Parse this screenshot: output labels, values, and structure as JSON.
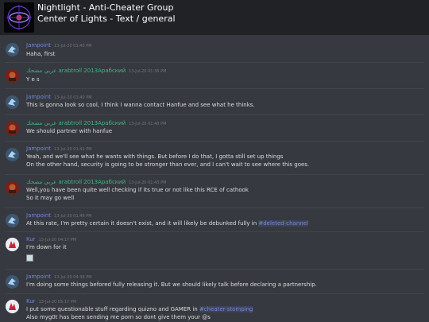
{
  "header": {
    "guild_name": "Nightlight - Anti-Cheater Group",
    "channel_name": "Center of Lights - Text / general"
  },
  "messages": [
    {
      "author": "Jampoint",
      "timestamp": "13-Jul-20 01:40 PM",
      "lines": [
        "Haha, first"
      ]
    },
    {
      "author": "عربي مضحك arabtroll 2013Арабский",
      "timestamp": "13-Jul-20 01:36 PM",
      "lines": [
        "Y e s"
      ]
    },
    {
      "author": "Jampoint",
      "timestamp": "13-Jul-20 01:40 PM",
      "lines": [
        "This is gonna look so cool, I think I wanna contact Hanfue and see what he thinks."
      ]
    },
    {
      "author": "عربي مضحك arabtroll 2013Арабский",
      "timestamp": "13-Jul-20 01:40 PM",
      "lines": [
        "We should partner with hanfue"
      ]
    },
    {
      "author": "Jampoint",
      "timestamp": "13-Jul-20 01:41 PM",
      "lines": [
        "Yeah, and we'll see what he wants with things. But before I do that, I gotta still set up things",
        "On the other hand, security is going to be stronger than ever, and I can't wait to see where this goes."
      ]
    },
    {
      "author": "عربي مضحك arabtroll 2013Арабский",
      "timestamp": "13-Jul-20 01:43 PM",
      "lines": [
        "Well,you have been quite well checking if its true or not like this RCE of cathook",
        "So it may go well"
      ]
    },
    {
      "author": "Jampoint",
      "timestamp": "13-Jul-20 01:46 PM",
      "lines": [
        "At this rate, I'm pretty certain it doesn't exist, and it will likely be debunked fully in "
      ],
      "mention": "#deleted-channel"
    },
    {
      "author": "Kur",
      "timestamp": "13-Jul-20 04:17 PM",
      "lines": [
        "I'm down for it"
      ]
    },
    {
      "author": "Jampoint",
      "timestamp": "13-Jul-20 04:38 PM",
      "lines": [
        "I'm doing some things befored fully releasing it. But we should likely talk before declaring a partnership."
      ]
    },
    {
      "author": "Kur",
      "timestamp": "13-Jul-20 05:17 PM",
      "lines": [
        "I put some questionable stuff regarding quizno and GAMER in ",
        "Also myg0t has been sending me porn so dont give them your @s"
      ],
      "mention": "#cheater-stomping"
    }
  ]
}
